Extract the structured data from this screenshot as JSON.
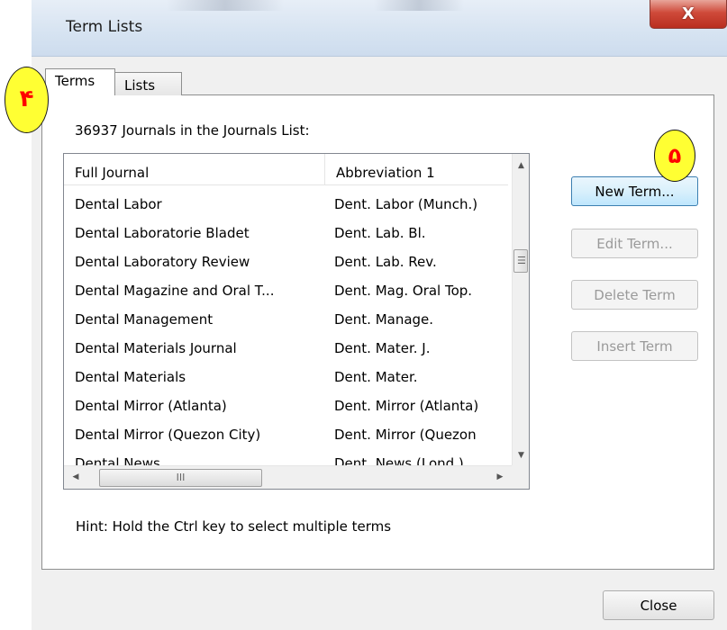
{
  "window": {
    "title": "Term Lists",
    "close_glyph": "X"
  },
  "tabs": [
    {
      "label": "Terms",
      "selected": true
    },
    {
      "label": "Lists",
      "selected": false
    }
  ],
  "list_summary": "36937 Journals in the Journals List:",
  "table": {
    "columns": [
      "Full Journal",
      "Abbreviation 1"
    ],
    "rows": [
      [
        "Dental Labor",
        "Dent. Labor (Munch.)"
      ],
      [
        "Dental Laboratorie Bladet",
        "Dent. Lab. Bl."
      ],
      [
        "Dental Laboratory Review",
        "Dent. Lab. Rev."
      ],
      [
        "Dental Magazine and Oral T...",
        "Dent. Mag. Oral Top."
      ],
      [
        "Dental Management",
        "Dent. Manage."
      ],
      [
        "Dental Materials Journal",
        "Dent. Mater. J."
      ],
      [
        "Dental Materials",
        "Dent. Mater."
      ],
      [
        "Dental Mirror (Atlanta)",
        "Dent. Mirror (Atlanta)"
      ],
      [
        "Dental Mirror (Quezon City)",
        "Dent. Mirror (Quezon"
      ],
      [
        "Dental News",
        "Dent. News (Lond.)"
      ]
    ]
  },
  "scrollbars": {
    "vertical_grip": "☰",
    "horizontal_grip": "III"
  },
  "buttons": {
    "new_term": "New Term...",
    "edit_term": "Edit Term...",
    "delete_term": "Delete Term",
    "insert_term": "Insert Term",
    "close": "Close"
  },
  "hint": "Hint: Hold the Ctrl key to select multiple terms",
  "annotations": {
    "marker_tab": "۴",
    "marker_button": "۵"
  },
  "colors": {
    "marker_fill": "#ffff33",
    "marker_text": "#ff0000",
    "close_button": "#c9463a",
    "highlight_button": "#bee6fd"
  }
}
